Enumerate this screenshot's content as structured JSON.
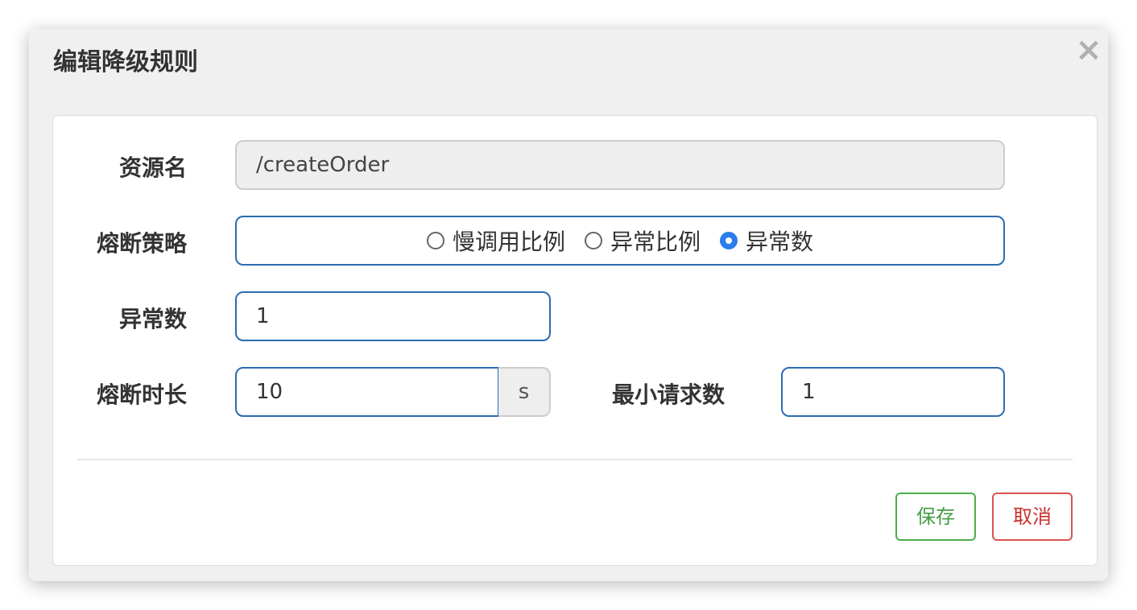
{
  "dialog": {
    "title": "编辑降级规则",
    "close_label": "×"
  },
  "form": {
    "resource": {
      "label": "资源名",
      "value": "/createOrder"
    },
    "strategy": {
      "label": "熔断策略",
      "options": [
        {
          "label": "慢调用比例",
          "checked": false
        },
        {
          "label": "异常比例",
          "checked": false
        },
        {
          "label": "异常数",
          "checked": true
        }
      ]
    },
    "exception_count": {
      "label": "异常数",
      "value": "1"
    },
    "break_duration": {
      "label": "熔断时长",
      "value": "10",
      "unit": "s"
    },
    "min_requests": {
      "label": "最小请求数",
      "value": "1"
    }
  },
  "actions": {
    "save_label": "保存",
    "cancel_label": "取消"
  },
  "colors": {
    "accent": "#2b6cb0",
    "radio_checked": "#2b7de9",
    "save": "#449d44",
    "cancel": "#c9302c"
  }
}
